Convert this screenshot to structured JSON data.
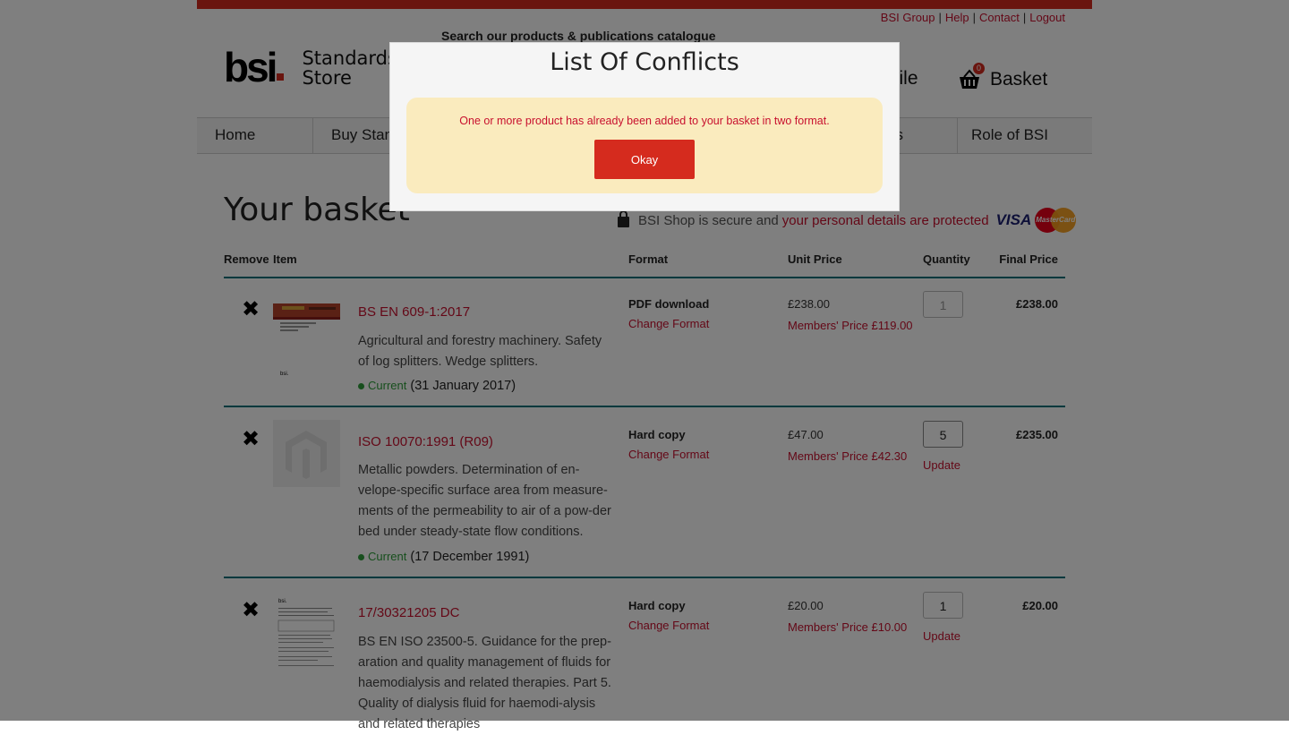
{
  "util_links": [
    "BSI Group",
    "Help",
    "Contact",
    "Logout"
  ],
  "logo": {
    "mark": "bsi",
    "line1": "Standards",
    "line2": "Store"
  },
  "search_caption": "Search our products & publications catalogue",
  "header": {
    "profile": "rofile",
    "basket_label": "Basket",
    "basket_count": "0"
  },
  "nav": [
    {
      "label": "Home"
    },
    {
      "label": "Buy Stand"
    },
    {
      "label": ""
    },
    {
      "label": ""
    },
    {
      "label": "s"
    },
    {
      "label": "Role of BSI"
    }
  ],
  "page_title": "Your basket",
  "secure": {
    "text1": "BSI Shop is secure and",
    "text2": "your personal details",
    "text3": "are protected",
    "visa": "VISA",
    "mastercard": "MasterCard"
  },
  "table": {
    "headers": {
      "remove": "Remove",
      "item": "Item",
      "format": "Format",
      "unit_price": "Unit Price",
      "quantity": "Quantity",
      "final_price": "Final Price"
    },
    "rows": [
      {
        "title": "BS EN 609-1:2017",
        "description": "Agricultural and forestry machinery. Safety of log splitters. Wedge splitters.",
        "status": "Current",
        "date": "(31 January 2017)",
        "format": "PDF download",
        "change_format": "Change Format",
        "unit_price": "£238.00",
        "members_price": "Members' Price £119.00",
        "quantity": "1",
        "update": "",
        "final_price": "£238.00"
      },
      {
        "title": "ISO 10070:1991 (R09)",
        "description": "Metallic powders. Determination of en-velope-specific surface area from measure-ments of the permeability to air of a pow-der bed under steady-state flow conditions.",
        "status": "Current",
        "date": "(17 December 1991)",
        "format": "Hard copy",
        "change_format": "Change Format",
        "unit_price": "£47.00",
        "members_price": "Members' Price £42.30",
        "quantity": "5",
        "update": "Update",
        "final_price": "£235.00"
      },
      {
        "title": "17/30321205 DC",
        "description": "BS EN ISO 23500-5. Guidance for the prep-aration and quality management of fluids for haemodialysis and related therapies. Part 5. Quality of dialysis fluid for haemodi-alysis and related therapies",
        "status": "",
        "date": "",
        "format": "Hard copy",
        "change_format": "Change Format",
        "unit_price": "£20.00",
        "members_price": "Members' Price £10.00",
        "quantity": "1",
        "update": "Update",
        "final_price": "£20.00"
      }
    ]
  },
  "modal": {
    "title": "List Of Conflicts",
    "message": "One or more product has already been added to your basket in two format.",
    "okay_label": "Okay"
  },
  "colors": {
    "brand_red": "#d52b1e",
    "link_red": "#c8102e",
    "teal_rule": "#00717a",
    "status_green": "#2e9e3a",
    "modal_box": "#faebbe"
  }
}
